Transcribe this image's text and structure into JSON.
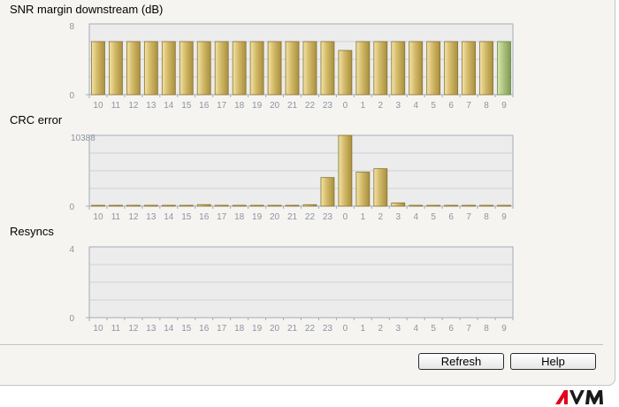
{
  "colors": {
    "bar": "#d2b867",
    "bar_dark": "#a8903f",
    "bar_highlight": "#a9c07a",
    "plot_bg": "#ececec",
    "grid": "#cdd2d8",
    "axis": "#a4adb8",
    "tick_text": "#8b94a0",
    "logo_red": "#e2001a"
  },
  "buttons": {
    "refresh_label": "Refresh",
    "help_label": "Help"
  },
  "logo": {
    "name": "avm-logo",
    "text": "AVM"
  },
  "chart_data": [
    {
      "type": "bar",
      "title": "SNR margin downstream (dB)",
      "categories": [
        "10",
        "11",
        "12",
        "13",
        "14",
        "15",
        "16",
        "17",
        "18",
        "19",
        "20",
        "21",
        "22",
        "23",
        "0",
        "1",
        "2",
        "3",
        "4",
        "5",
        "6",
        "7",
        "8",
        "9"
      ],
      "values": [
        6,
        6,
        6,
        6,
        6,
        6,
        6,
        6,
        6,
        6,
        6,
        6,
        6,
        6,
        5,
        6,
        6,
        6,
        6,
        6,
        6,
        6,
        6,
        6
      ],
      "highlight_index": 23,
      "ylim": [
        0,
        8
      ],
      "y_ticks": [
        "0",
        "8"
      ],
      "xlabel": "",
      "ylabel": "",
      "grid": true
    },
    {
      "type": "bar",
      "title": "CRC error",
      "categories": [
        "10",
        "11",
        "12",
        "13",
        "14",
        "15",
        "16",
        "17",
        "18",
        "19",
        "20",
        "21",
        "22",
        "23",
        "0",
        "1",
        "2",
        "3",
        "4",
        "5",
        "6",
        "7",
        "8",
        "9"
      ],
      "values": [
        20,
        15,
        10,
        10,
        10,
        10,
        230,
        10,
        10,
        10,
        10,
        10,
        220,
        4200,
        10388,
        5000,
        5500,
        480,
        10,
        20,
        10,
        10,
        10,
        10
      ],
      "ylim": [
        0,
        10388
      ],
      "y_ticks": [
        "0",
        "10388"
      ],
      "xlabel": "",
      "ylabel": "",
      "grid": true
    },
    {
      "type": "bar",
      "title": "Resyncs",
      "categories": [
        "10",
        "11",
        "12",
        "13",
        "14",
        "15",
        "16",
        "17",
        "18",
        "19",
        "20",
        "21",
        "22",
        "23",
        "0",
        "1",
        "2",
        "3",
        "4",
        "5",
        "6",
        "7",
        "8",
        "9"
      ],
      "values": [
        0,
        0,
        0,
        0,
        0,
        0,
        0,
        0,
        0,
        0,
        0,
        0,
        0,
        0,
        0,
        0,
        0,
        0,
        0,
        0,
        0,
        0,
        0,
        0
      ],
      "ylim": [
        0,
        4
      ],
      "y_ticks": [
        "0",
        "4"
      ],
      "xlabel": "",
      "ylabel": "",
      "grid": true
    }
  ]
}
